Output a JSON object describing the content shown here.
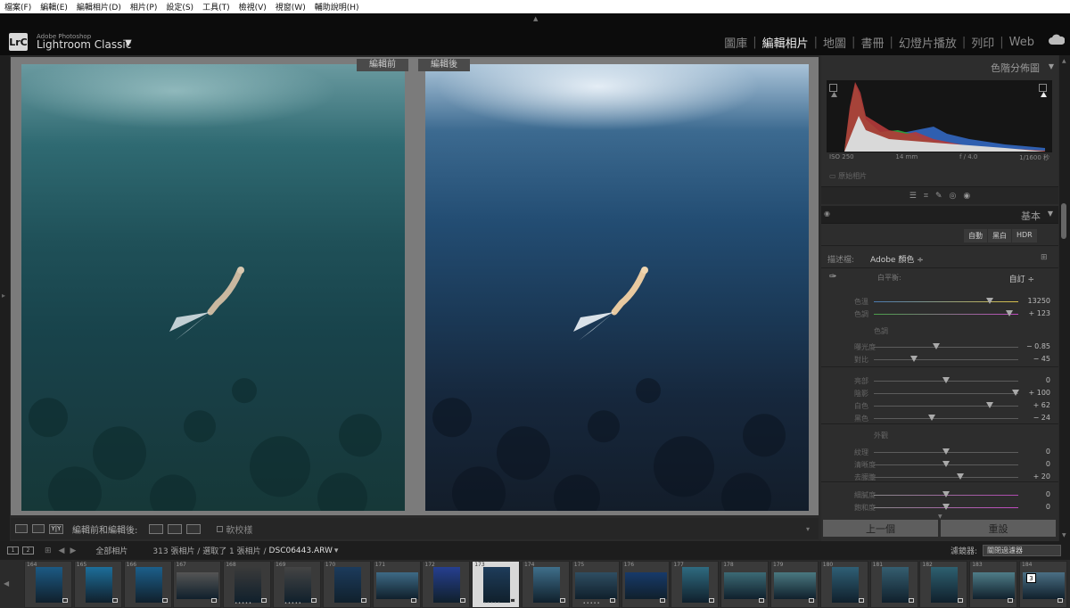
{
  "menu": [
    "檔案(F)",
    "編輯(E)",
    "編輯相片(D)",
    "相片(P)",
    "設定(S)",
    "工具(T)",
    "檢視(V)",
    "視窗(W)",
    "輔助說明(H)"
  ],
  "brand": {
    "logo": "LrC",
    "small": "Adobe Photoshop",
    "name": "Lightroom Classic",
    "arrow": "▼"
  },
  "modules": [
    {
      "label": "圖庫",
      "active": false
    },
    {
      "label": "編輯相片",
      "active": true
    },
    {
      "label": "地圖",
      "active": false
    },
    {
      "label": "書冊",
      "active": false
    },
    {
      "label": "幻燈片播放",
      "active": false
    },
    {
      "label": "列印",
      "active": false
    },
    {
      "label": "Web",
      "active": false
    }
  ],
  "view": {
    "before_label": "編輯前",
    "after_label": "編輯後"
  },
  "toolbar": {
    "yy": "Y|Y",
    "label": "編輯前和編輯後:",
    "soft_proof": "軟校樣"
  },
  "panels": {
    "histogram": {
      "title": "色階分佈圖",
      "iso": "ISO 250",
      "focal": "14 mm",
      "aperture": "f / 4.0",
      "shutter": "1/1600 秒",
      "original": "原始相片"
    },
    "basic": {
      "title": "基本",
      "buttons": {
        "auto": "自動",
        "bw": "黑白",
        "hdr": "HDR"
      },
      "profile_label": "描述檔:",
      "profile_value": "Adobe 顏色 ÷",
      "wb_label": "白平衡:",
      "wb_value": "自訂 ÷",
      "sections": {
        "tone": "色調",
        "presence": "外觀"
      },
      "wb_sliders": [
        {
          "label": "色溫",
          "value": "13250",
          "pos": 0.8
        },
        {
          "label": "色調",
          "value": "+ 123",
          "pos": 0.94
        }
      ],
      "tone_sliders": [
        {
          "label": "曝光度",
          "value": "− 0.85",
          "pos": 0.43
        },
        {
          "label": "對比",
          "value": "− 45",
          "pos": 0.28
        }
      ],
      "light_sliders": [
        {
          "label": "亮部",
          "value": "0",
          "pos": 0.5
        },
        {
          "label": "陰影",
          "value": "+ 100",
          "pos": 0.98
        },
        {
          "label": "白色",
          "value": "+ 62",
          "pos": 0.8
        },
        {
          "label": "黑色",
          "value": "− 24",
          "pos": 0.4
        }
      ],
      "presence_sliders": [
        {
          "label": "紋理",
          "value": "0",
          "pos": 0.5
        },
        {
          "label": "清晰度",
          "value": "0",
          "pos": 0.5
        },
        {
          "label": "去朦朧",
          "value": "+ 20",
          "pos": 0.6
        }
      ],
      "color_sliders": [
        {
          "label": "細膩度",
          "value": "0",
          "pos": 0.5
        },
        {
          "label": "飽和度",
          "value": "0",
          "pos": 0.5
        }
      ]
    }
  },
  "nav": {
    "prev": "上一個",
    "reset": "重設"
  },
  "filmstrip_bar": {
    "page1": "1",
    "page2": "2",
    "source": "全部相片",
    "info": "313 張相片 / 選取了 1 張相片 /",
    "filename": "DSC06443.ARW",
    "filename_arrow": "▾",
    "filter_label": "濾鏡器:",
    "filter_value": "關閉過濾器"
  },
  "filmstrip": [
    {
      "num": "164",
      "color": "#1c5a84",
      "wide": false
    },
    {
      "num": "165",
      "color": "#1d6e9a",
      "wide": false
    },
    {
      "num": "166",
      "color": "#1c5f8a",
      "wide": false
    },
    {
      "num": "167",
      "color": "#555555",
      "wide": true
    },
    {
      "num": "168",
      "color": "#3a3a3a",
      "wide": false
    },
    {
      "num": "169",
      "color": "#444444",
      "wide": false
    },
    {
      "num": "170",
      "color": "#1c3b5c",
      "wide": false
    },
    {
      "num": "171",
      "color": "#3e6a85",
      "wide": true
    },
    {
      "num": "172",
      "color": "#263f8f",
      "wide": false
    },
    {
      "num": "173",
      "color": "#1e3c5a",
      "wide": false,
      "sel": true
    },
    {
      "num": "174",
      "color": "#3f6f8a",
      "wide": false
    },
    {
      "num": "175",
      "color": "#2f4e62",
      "wide": true
    },
    {
      "num": "176",
      "color": "#173a6a",
      "wide": true
    },
    {
      "num": "177",
      "color": "#2f6b80",
      "wide": false
    },
    {
      "num": "178",
      "color": "#3c6a75",
      "wide": true
    },
    {
      "num": "179",
      "color": "#4a7880",
      "wide": true
    },
    {
      "num": "180",
      "color": "#2f5f75",
      "wide": false
    },
    {
      "num": "181",
      "color": "#355e70",
      "wide": false
    },
    {
      "num": "182",
      "color": "#2e6070",
      "wide": false
    },
    {
      "num": "183",
      "color": "#4f7d88",
      "wide": true
    },
    {
      "num": "184",
      "color": "#4b6f84",
      "wide": true
    }
  ],
  "badge": "3"
}
